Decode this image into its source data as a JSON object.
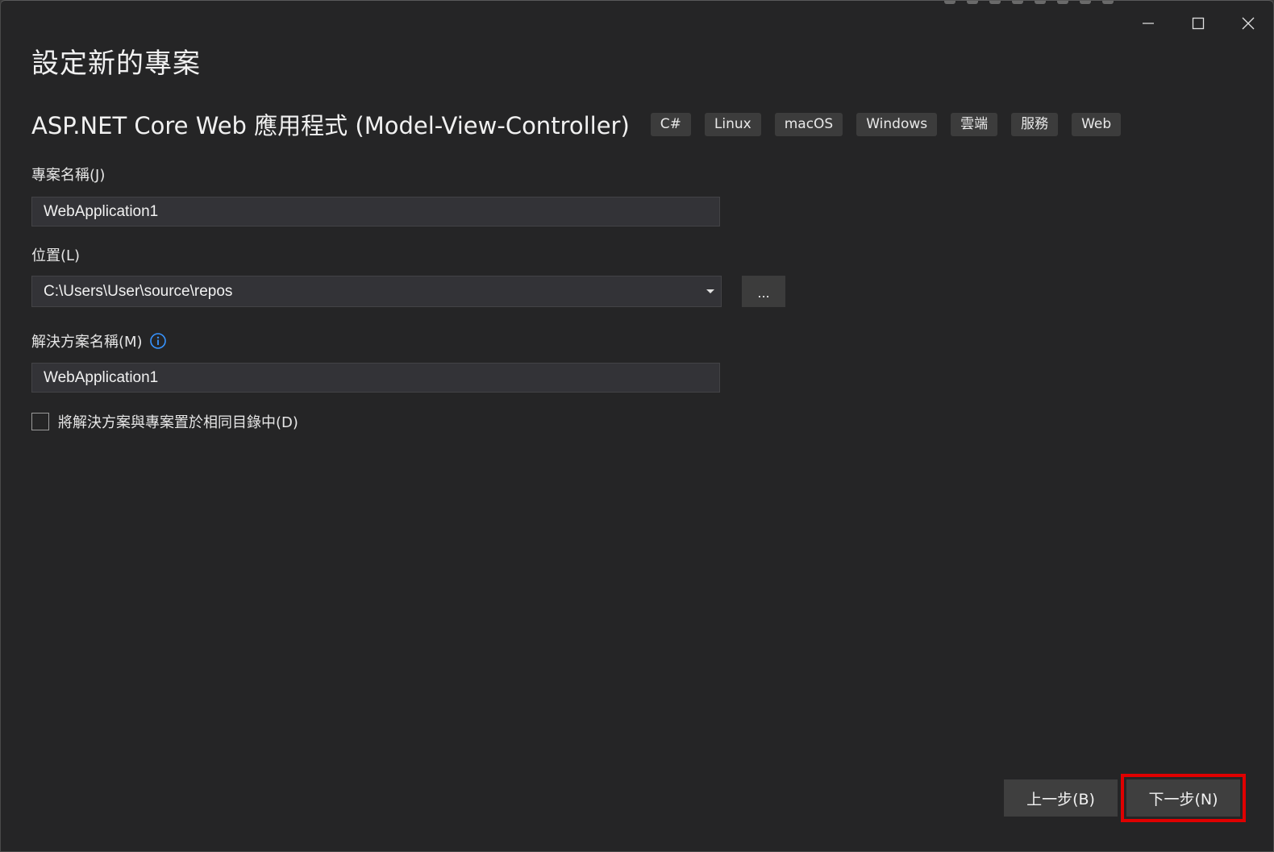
{
  "window": {
    "title": "設定新的專案",
    "controls": {
      "minimize_icon": "minimize-icon",
      "maximize_icon": "maximize-icon",
      "close_icon": "close-icon"
    }
  },
  "template": {
    "name": "ASP.NET Core Web 應用程式 (Model-View-Controller)",
    "tags": [
      "C#",
      "Linux",
      "macOS",
      "Windows",
      "雲端",
      "服務",
      "Web"
    ]
  },
  "project_name": {
    "label": "專案名稱(J)",
    "value": "WebApplication1"
  },
  "location": {
    "label": "位置(L)",
    "value": "C:\\Users\\User\\source\\repos",
    "browse_label": "..."
  },
  "solution_name": {
    "label": "解決方案名稱(M)",
    "value": "WebApplication1",
    "info_icon": "info-icon"
  },
  "same_directory": {
    "label": "將解決方案與專案置於相同目錄中(D)",
    "checked": false
  },
  "footer": {
    "back_label": "上一步(B)",
    "next_label": "下一步(N)",
    "highlight_color": "#e00000"
  },
  "colors": {
    "background": "#252526",
    "input_bg": "#333337",
    "tag_bg": "#3c3c3c",
    "button_bg": "#3f3f3f",
    "accent_info": "#3794ff"
  }
}
